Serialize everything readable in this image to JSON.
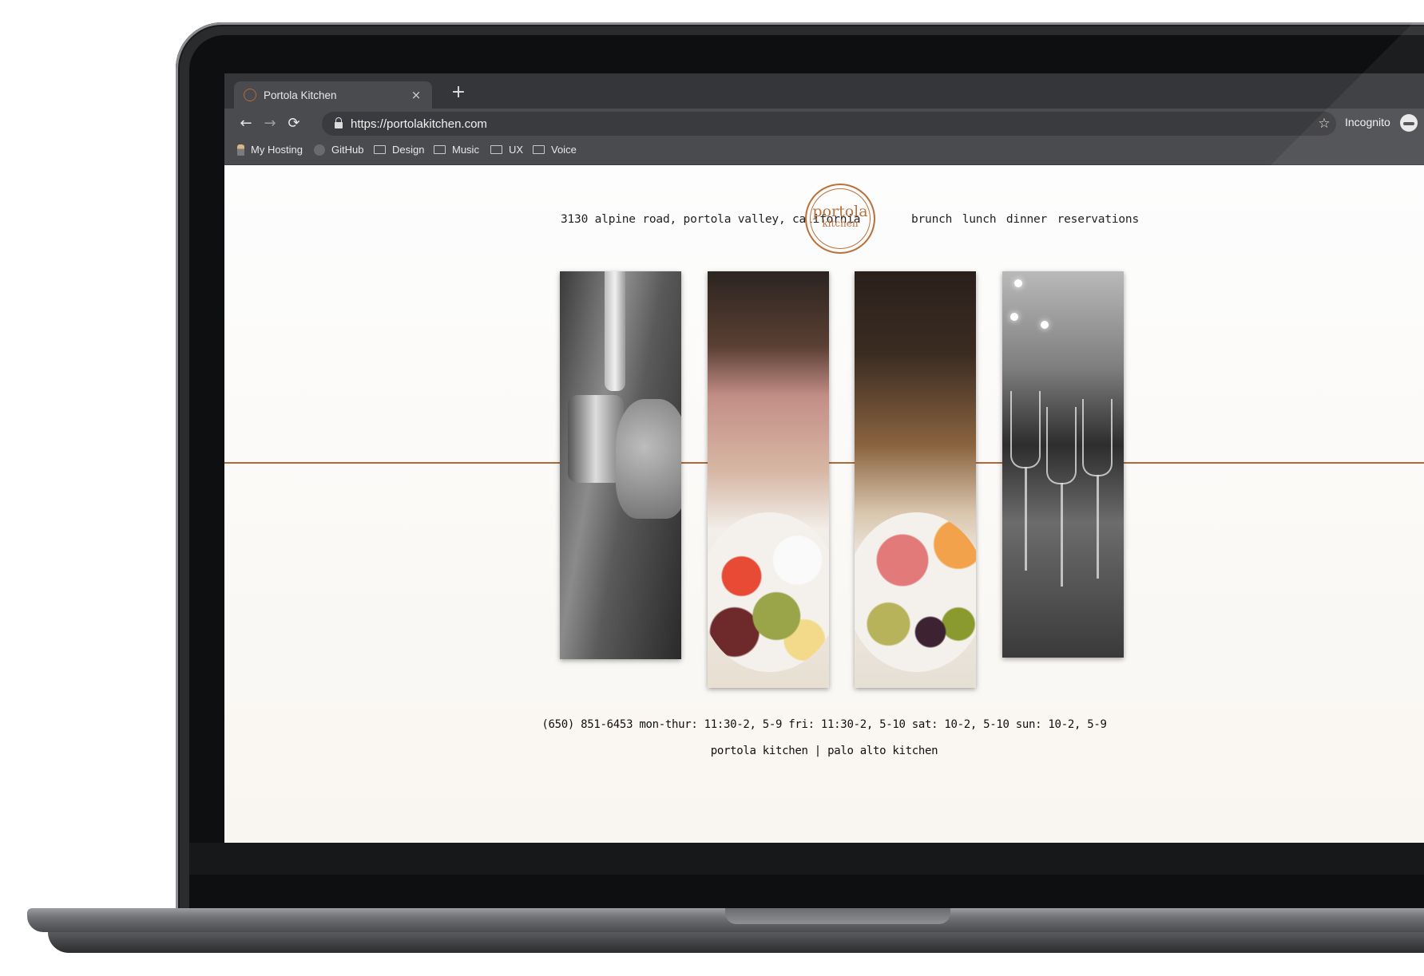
{
  "browser": {
    "tab_title": "Portola Kitchen",
    "tab_close": "×",
    "new_tab": "+",
    "url": "https://portolakitchen.com",
    "incognito_label": "Incognito",
    "nav": {
      "back": "←",
      "forward": "→",
      "reload": "⟳",
      "star": "☆"
    },
    "bookmarks": [
      {
        "label": "My Hosting",
        "icon": "hosting-icon"
      },
      {
        "label": "GitHub",
        "icon": "github-icon"
      },
      {
        "label": "Design",
        "icon": "folder-icon"
      },
      {
        "label": "Music",
        "icon": "folder-icon"
      },
      {
        "label": "UX",
        "icon": "folder-icon"
      },
      {
        "label": "Voice",
        "icon": "folder-icon"
      }
    ]
  },
  "site": {
    "address": "3130 alpine road, portola valley, california",
    "logo": {
      "line1": "portola",
      "line2": "kitchen"
    },
    "nav": [
      "brunch",
      "lunch",
      "dinner",
      "reservations"
    ],
    "contact_line": "(650) 851-6453 mon-thur: 11:30-2, 5-9 fri: 11:30-2, 5-10 sat: 10-2, 5-10 sun: 10-2, 5-9",
    "footer_links": {
      "first": "portola kitchen",
      "separator": "|",
      "second": "palo alto kitchen"
    },
    "accent_color": "#b06a35"
  }
}
